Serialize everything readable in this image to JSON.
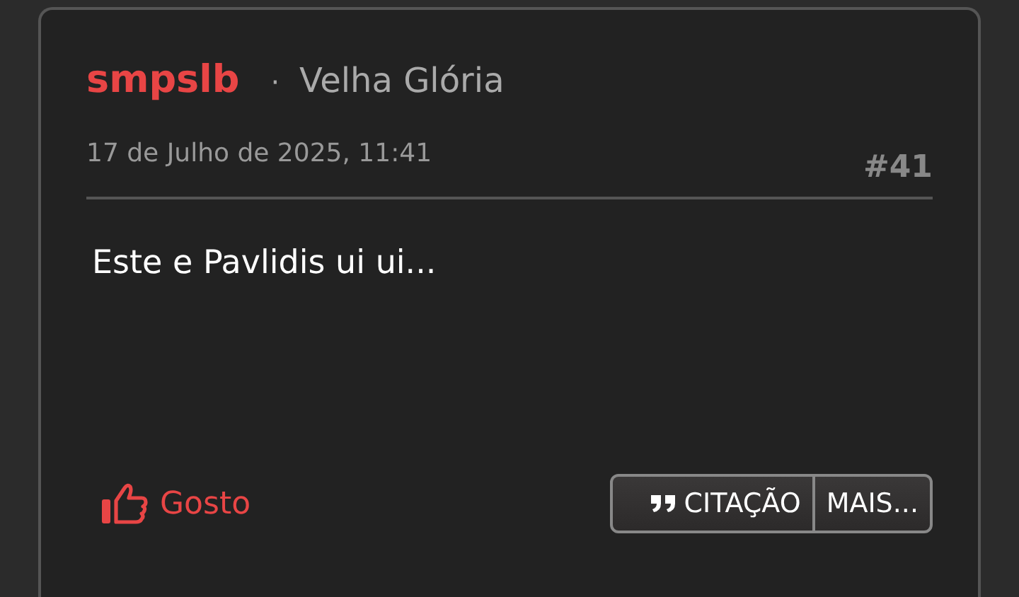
{
  "post": {
    "author": "smpslb",
    "separator": "·",
    "rank": "Velha Glória",
    "date": "17 de Julho de 2025, 11:41",
    "number": "#41",
    "body": "Este e Pavlidis ui ui...",
    "like_label": "Gosto",
    "buttons": [
      {
        "label": "CITAÇÃO",
        "kind": "quote"
      },
      {
        "label": "MAIS...",
        "kind": "more"
      }
    ]
  }
}
